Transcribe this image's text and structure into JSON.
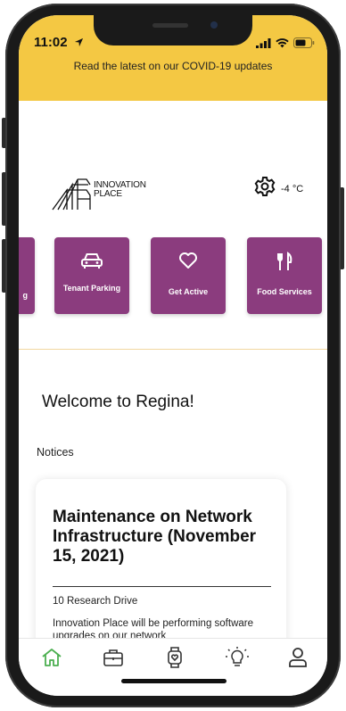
{
  "status_bar": {
    "time": "11:02"
  },
  "banner": {
    "text": "Read the latest on our COVID-19 updates",
    "color": "#f4c843"
  },
  "header": {
    "logo_text_line1": "INNOVATION",
    "logo_text_line2": "PLACE",
    "weather_icon": "gear-icon",
    "temperature": "-4 °C"
  },
  "tiles": [
    {
      "label": "g",
      "icon": "partial-tile-icon"
    },
    {
      "label": "Tenant Parking",
      "icon": "car-icon"
    },
    {
      "label": "Get Active",
      "icon": "heart-icon"
    },
    {
      "label": "Food Services",
      "icon": "utensils-icon"
    }
  ],
  "accent_color": "#8b3c7e",
  "welcome": "Welcome to Regina!",
  "notices_heading": "Notices",
  "notice": {
    "title": "Maintenance on Network Infrastructure (November 15, 2021)",
    "location": "10 Research Drive",
    "body": "Innovation Place will be performing software upgrades on our network"
  },
  "bottom_nav": [
    {
      "name": "home",
      "icon": "home-icon",
      "active": true
    },
    {
      "name": "briefcase",
      "icon": "briefcase-icon",
      "active": false
    },
    {
      "name": "watch",
      "icon": "smartwatch-icon",
      "active": false
    },
    {
      "name": "ideas",
      "icon": "lightbulb-icon",
      "active": false
    },
    {
      "name": "profile",
      "icon": "user-icon",
      "active": false
    }
  ]
}
